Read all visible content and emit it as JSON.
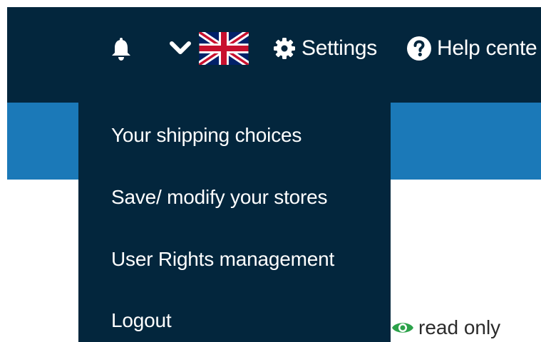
{
  "header": {
    "notifications_icon": "bell-icon",
    "language_toggle_icon": "chevron-down-icon",
    "language_flag": "uk-flag-icon",
    "settings": {
      "icon": "gear-icon",
      "label": "Settings"
    },
    "help": {
      "icon": "question-circle-icon",
      "label": "Help cente"
    }
  },
  "settings_menu": {
    "items": [
      {
        "label": "Your shipping choices"
      },
      {
        "label": "Save/ modify your stores"
      },
      {
        "label": "User Rights management"
      },
      {
        "label": "Logout"
      }
    ]
  },
  "access_mode": {
    "icon": "eye-icon",
    "label": "read only",
    "icon_color": "#2ca24a"
  },
  "colors": {
    "topbar": "#03263d",
    "band": "#1b79b8",
    "dropdown": "#03263d",
    "text_light": "#ffffff",
    "text_dark": "#2b2b2b"
  }
}
